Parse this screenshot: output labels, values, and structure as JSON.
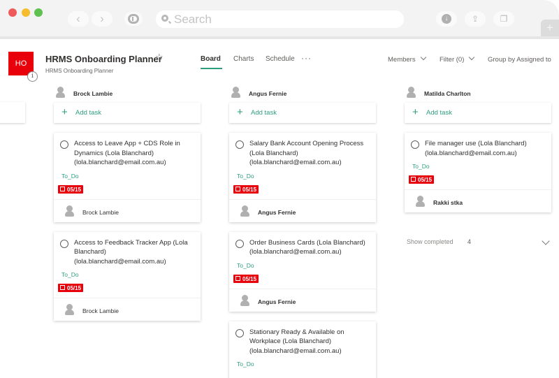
{
  "browser": {
    "search_placeholder": "Search",
    "back_icon": "‹",
    "forward_icon": "›",
    "download_icon": "↓",
    "share_icon": "⇪",
    "tabs_icon": "❐",
    "new_tab_icon": "+"
  },
  "plan": {
    "icon_initials": "HO",
    "icon_color": "#e8000b",
    "info_icon": "i",
    "title": "HRMS Onboarding Planner",
    "star_icon": "☆",
    "subtitle": "HRMS Onboarding Planner"
  },
  "tabs": [
    {
      "label": "Board",
      "active": true
    },
    {
      "label": "Charts",
      "active": false
    },
    {
      "label": "Schedule",
      "active": false
    }
  ],
  "more_label": "···",
  "controls": {
    "members": "Members",
    "filter": "Filter (0)",
    "group_by": "Group by Assigned to"
  },
  "accent_color": "#2e9e7f",
  "add_task_label": "Add task",
  "add_icon": "+",
  "columns": [
    {
      "name": "Brock Lambie",
      "cards": [
        {
          "title": "Access to Leave App + CDS Role in Dynamics (Lola Blanchard) (lola.blanchard@email.com.au)",
          "bucket": "To_Do",
          "due": "05/15",
          "assignee": "Brock Lambie"
        },
        {
          "title": "Access to Feedback Tracker App (Lola Blanchard) (lola.blanchard@email.com.au)",
          "bucket": "To_Do",
          "due": "05/15",
          "assignee": "Brock Lambie"
        }
      ]
    },
    {
      "name": "Angus Fernie",
      "cards": [
        {
          "title": "Salary Bank Account Opening Process (Lola Blanchard) (lola.blanchard@email.com.au)",
          "bucket": "To_Do",
          "due": "05/15",
          "assignee": "Angus Fernie"
        },
        {
          "title": "Order Business Cards (Lola Blanchard) (lola.blanchard@email.com.au)",
          "bucket": "To_Do",
          "due": "05/15",
          "assignee": "Angus Fernie"
        },
        {
          "title": "Stationary Ready & Available on Workplace (Lola Blanchard) (lola.blanchard@email.com.au)",
          "bucket": "To_Do"
        }
      ]
    },
    {
      "name": "Matilda Charlton",
      "cards": [
        {
          "title": "File manager use  (Lola Blanchard) (lola.blanchard@email.com.au)",
          "bucket": "To_Do",
          "due": "05/15",
          "assignee": "Rakki stka"
        }
      ]
    }
  ],
  "show_completed": {
    "label": "Show completed",
    "count": "4"
  },
  "due_color": "#e8000b"
}
